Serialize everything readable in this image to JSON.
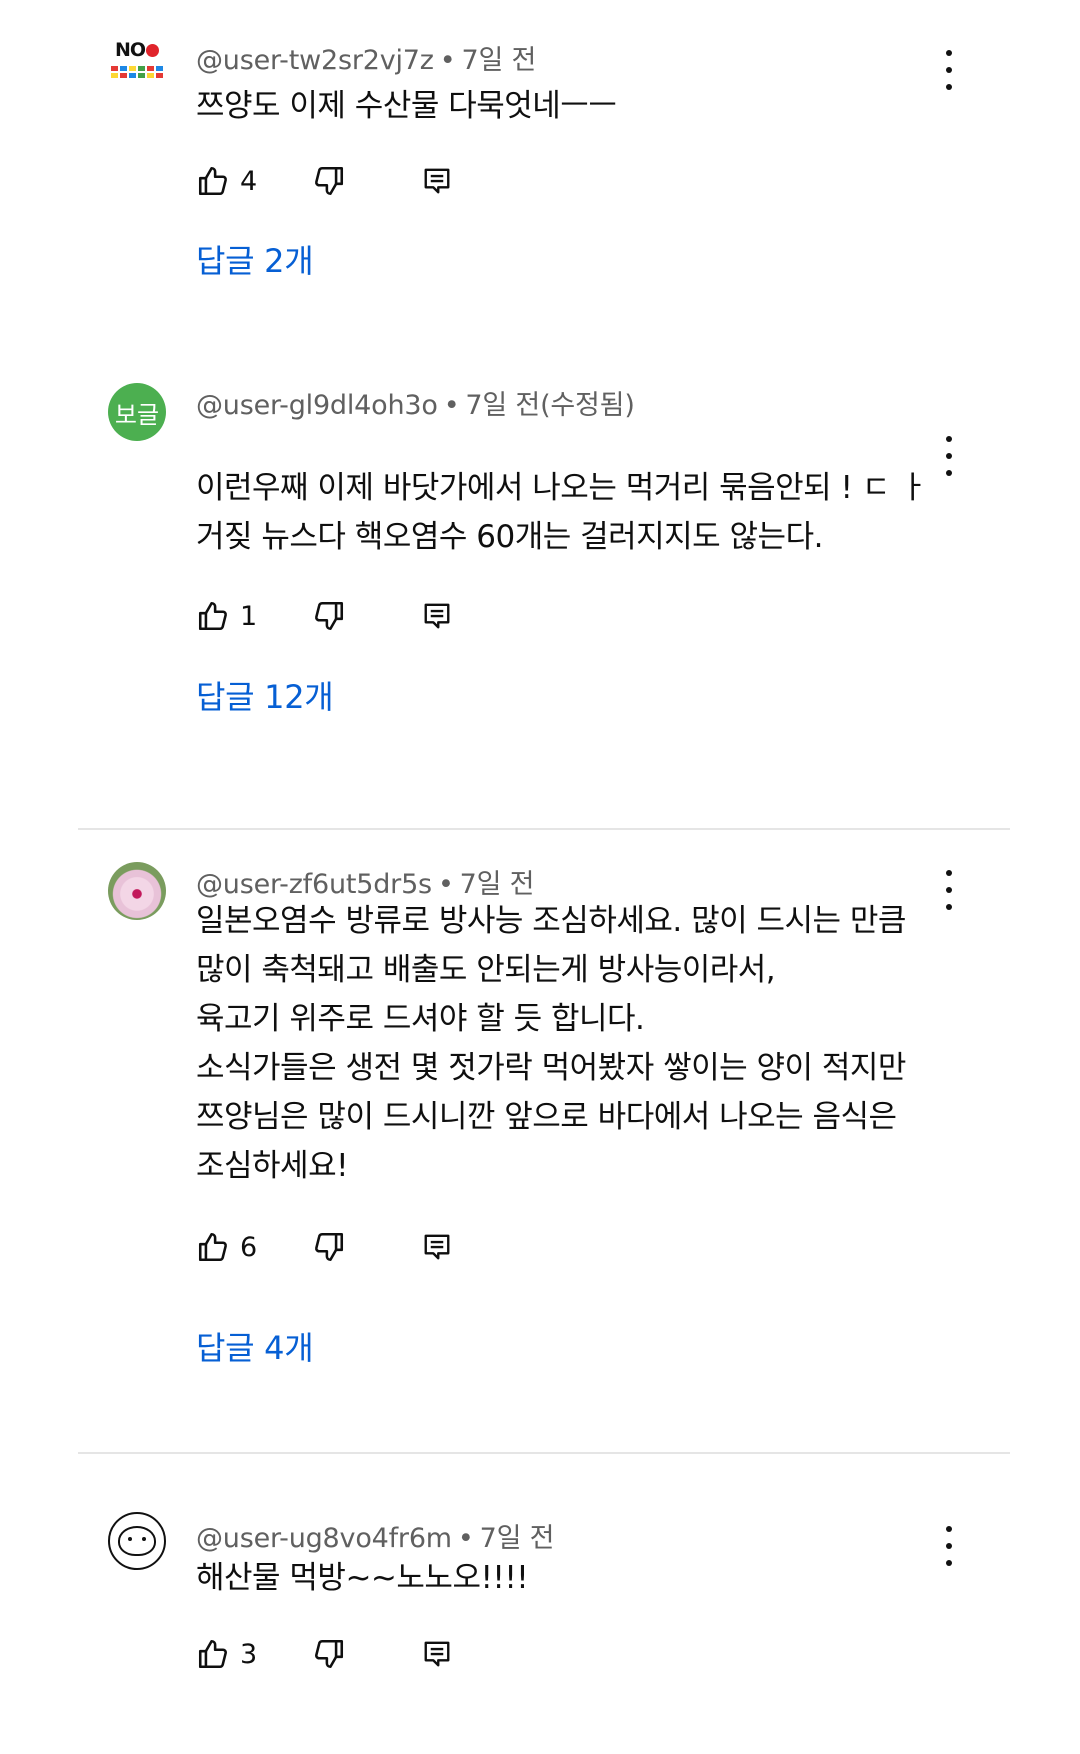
{
  "comments": [
    {
      "author": "@user-tw2sr2vj7z",
      "time": "7일 전",
      "lines": [
        "쯔양도 이제 수산물 다묵엇네ㅡㅡ"
      ],
      "likes": "4",
      "replies": "답글 2개",
      "avatar": "no-japan-avatar"
    },
    {
      "author": "@user-gl9dl4oh3o",
      "time": "7일 전(수정됨)",
      "avatar_text": "보글",
      "lines": [
        "이런우째 이제 바닷가에서 나오는 먹거리 묶음안되 ! ㄷ ㅏ",
        "거짖 뉴스다 핵오염수 60개는 걸러지지도 않는다."
      ],
      "likes": "1",
      "replies": "답글 12개",
      "avatar": "green-text-avatar"
    },
    {
      "author": "@user-zf6ut5dr5s",
      "time": "7일 전",
      "lines": [
        "일본오염수 방류로 방사능 조심하세요. 많이 드시는 만큼",
        "많이 축척돼고 배출도 안되는게 방사능이라서,",
        "육고기 위주로 드셔야 할 듯 합니다.",
        "소식가들은 생전 몇 젓가락 먹어봤자 쌓이는 양이 적지만",
        "쯔양님은 많이 드시니깐 앞으로 바다에서 나오는 음식은",
        "조심하세요!"
      ],
      "likes": "6",
      "replies": "답글 4개",
      "avatar": "flower-avatar"
    },
    {
      "author": "@user-ug8vo4fr6m",
      "time": "7일 전",
      "lines": [
        "해산물 먹방~~노노오!!!!"
      ],
      "likes": "3",
      "avatar": "cat-avatar"
    }
  ],
  "avatar_no_text": "NO",
  "icons": {
    "like": "thumbs-up-icon",
    "dislike": "thumbs-down-icon",
    "reply": "reply-comment-icon",
    "more": "more-vertical-icon"
  },
  "colors": {
    "link": "#065fd4",
    "meta": "#606060",
    "divider": "#e5e5e5"
  }
}
